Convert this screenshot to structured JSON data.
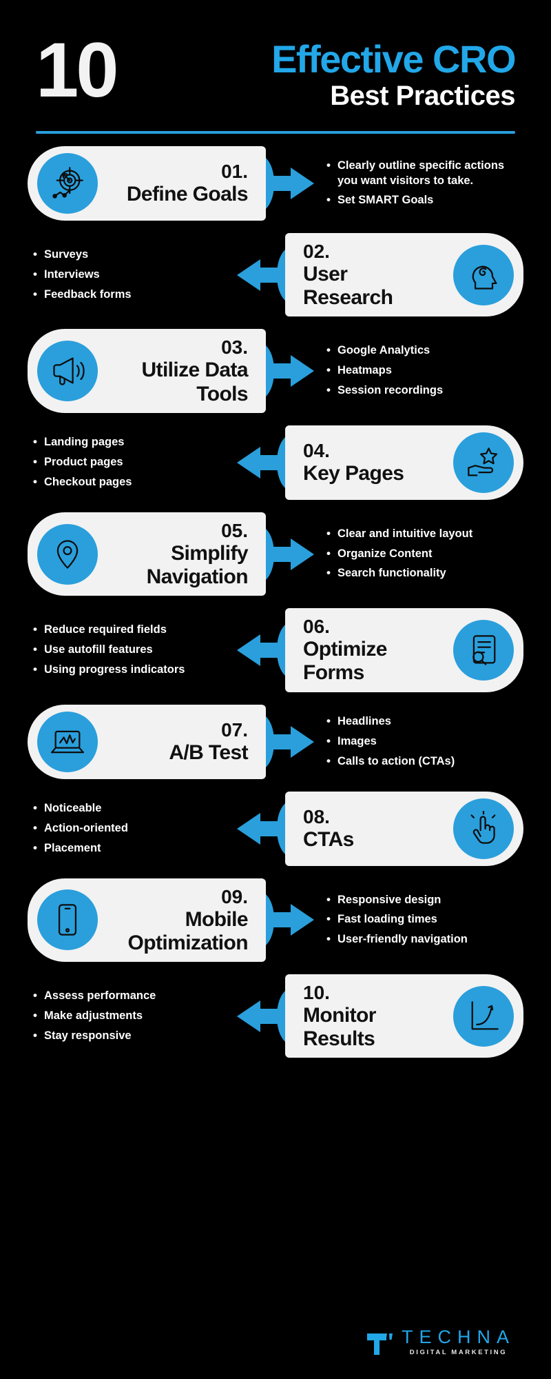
{
  "header": {
    "number": "10",
    "title_main": "Effective CRO",
    "title_sub": "Best Practices",
    "accent": "#22a7e8"
  },
  "steps": [
    {
      "num": "01.",
      "name": "Define Goals",
      "icon": "target-goal-icon",
      "side": "left",
      "bullets": [
        "Clearly outline specific actions you want visitors to take.",
        "Set SMART Goals"
      ]
    },
    {
      "num": "02.",
      "name": "User Research",
      "icon": "head-brain-icon",
      "side": "right",
      "bullets": [
        "Surveys",
        "Interviews",
        "Feedback forms"
      ]
    },
    {
      "num": "03.",
      "name": "Utilize Data Tools",
      "icon": "megaphone-icon",
      "side": "left",
      "bullets": [
        "Google Analytics",
        "Heatmaps",
        "Session recordings"
      ]
    },
    {
      "num": "04.",
      "name": "Key Pages",
      "icon": "hand-star-icon",
      "side": "right",
      "bullets": [
        "Landing pages",
        "Product pages",
        "Checkout pages"
      ]
    },
    {
      "num": "05.",
      "name": "Simplify Navigation",
      "icon": "map-pin-icon",
      "side": "left",
      "bullets": [
        "Clear and intuitive layout",
        "Organize Content",
        "Search functionality"
      ]
    },
    {
      "num": "06.",
      "name": "Optimize Forms",
      "icon": "form-magnifier-icon",
      "side": "right",
      "bullets": [
        "Reduce required fields",
        "Use autofill features",
        "Using progress indicators"
      ]
    },
    {
      "num": "07.",
      "name": "A/B Test",
      "icon": "laptop-chart-icon",
      "side": "left",
      "bullets": [
        "Headlines",
        "Images",
        "Calls to action (CTAs)"
      ]
    },
    {
      "num": "08.",
      "name": "CTAs",
      "icon": "click-hand-icon",
      "side": "right",
      "bullets": [
        "Noticeable",
        "Action-oriented",
        "Placement"
      ]
    },
    {
      "num": "09.",
      "name": "Mobile Optimization",
      "icon": "mobile-phone-icon",
      "side": "left",
      "bullets": [
        "Responsive design",
        "Fast loading times",
        "User-friendly navigation"
      ]
    },
    {
      "num": "10.",
      "name": "Monitor Results",
      "icon": "growth-graph-icon",
      "side": "right",
      "bullets": [
        "Assess performance",
        "Make adjustments",
        "Stay responsive"
      ]
    }
  ],
  "footer": {
    "logo_name": "TECHNA",
    "logo_tagline": "DIGITAL MARKETING"
  }
}
